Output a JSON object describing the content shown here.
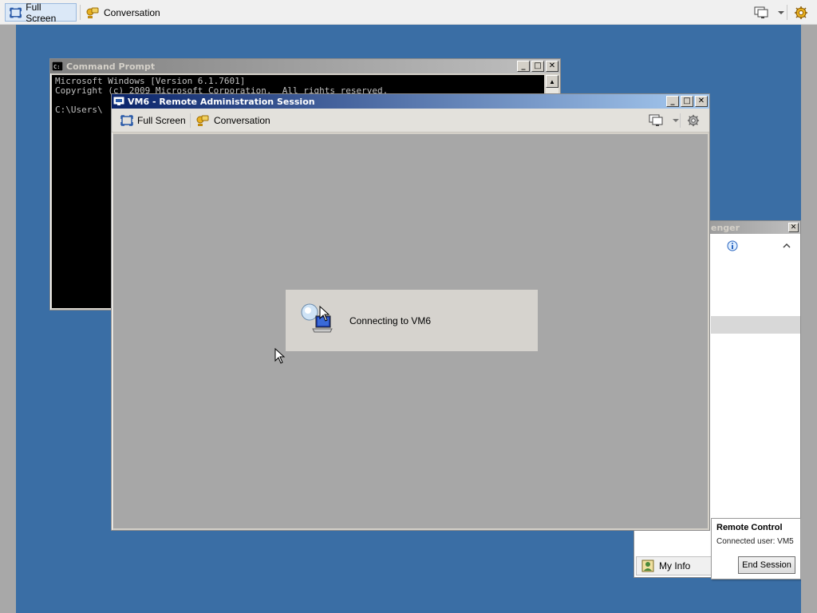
{
  "outer_toolbar": {
    "full_screen": "Full Screen",
    "conversation": "Conversation"
  },
  "cmd_window": {
    "title": "Command Prompt",
    "lines": [
      "Microsoft Windows [Version 6.1.7601]",
      "Copyright (c) 2009 Microsoft Corporation.  All rights reserved.",
      "",
      "C:\\Users\\"
    ]
  },
  "session_window": {
    "title": "VM6 - Remote Administration Session",
    "full_screen": "Full Screen",
    "conversation": "Conversation",
    "status": "Connecting to VM6"
  },
  "messenger": {
    "title_partial": "enger",
    "my_info": "My Info"
  },
  "remote_popup": {
    "title": "Remote Control",
    "user_line": "Connected user: VM5",
    "end_session": "End Session"
  },
  "colors": {
    "desktop": "#3a6ea5",
    "active_title": "#0a246a",
    "session_bg": "#a7a7a7"
  }
}
